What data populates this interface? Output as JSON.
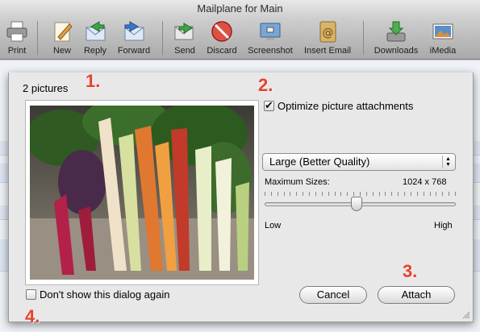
{
  "window": {
    "title": "Mailplane for Main"
  },
  "toolbar": {
    "buttons": [
      {
        "label": "Print",
        "icon": "printer-icon"
      },
      {
        "label": "New",
        "icon": "compose-icon"
      },
      {
        "label": "Reply",
        "icon": "reply-icon"
      },
      {
        "label": "Forward",
        "icon": "forward-icon"
      },
      {
        "label": "Send",
        "icon": "send-icon"
      },
      {
        "label": "Discard",
        "icon": "discard-icon"
      },
      {
        "label": "Screenshot",
        "icon": "screenshot-icon"
      },
      {
        "label": "Insert Email",
        "icon": "address-book-icon"
      },
      {
        "label": "Downloads",
        "icon": "downloads-icon"
      },
      {
        "label": "iMedia",
        "icon": "imedia-icon"
      }
    ]
  },
  "dialog": {
    "picture_count": "2 pictures",
    "optimize_label": "Optimize picture attachments",
    "optimize_checked": true,
    "quality_value": "Large (Better Quality)",
    "max_sizes_label": "Maximum Sizes:",
    "max_sizes_value": "1024 x 768",
    "slider_low": "Low",
    "slider_high": "High",
    "slider_level": 0.48,
    "dont_show_label": "Don't show this dialog again",
    "dont_show_checked": false,
    "cancel_label": "Cancel",
    "attach_label": "Attach",
    "preview_image": "rainbow-chard-photo"
  },
  "annotations": {
    "step1": "1.",
    "step2": "2.",
    "step3": "3.",
    "step4": "4."
  },
  "colors": {
    "annotation": "#e8412c",
    "toolbar_top": "#cfcfcf",
    "dialog_bg": "#e8e8e8"
  }
}
